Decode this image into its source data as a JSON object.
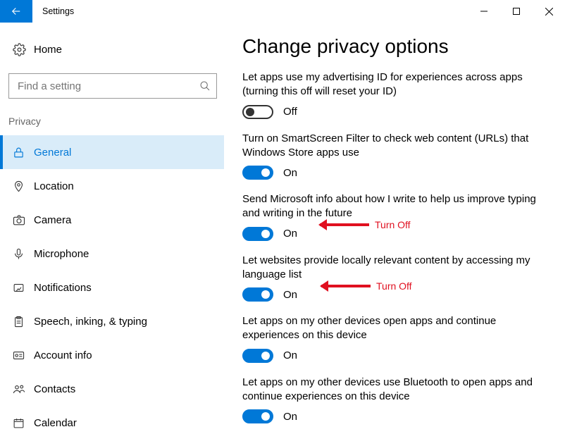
{
  "titlebar": {
    "app_title": "Settings"
  },
  "sidebar": {
    "home_label": "Home",
    "search_placeholder": "Find a setting",
    "section_header": "Privacy",
    "items": [
      {
        "label": "General"
      },
      {
        "label": "Location"
      },
      {
        "label": "Camera"
      },
      {
        "label": "Microphone"
      },
      {
        "label": "Notifications"
      },
      {
        "label": "Speech, inking, & typing"
      },
      {
        "label": "Account info"
      },
      {
        "label": "Contacts"
      },
      {
        "label": "Calendar"
      }
    ]
  },
  "main": {
    "heading": "Change privacy options",
    "toggles": [
      {
        "desc": "Let apps use my advertising ID for experiences across apps (turning this off will reset your ID)",
        "state_label": "Off",
        "on": false
      },
      {
        "desc": "Turn on SmartScreen Filter to check web content (URLs) that Windows Store apps use",
        "state_label": "On",
        "on": true
      },
      {
        "desc": "Send Microsoft info about how I write to help us improve typing and writing in the future",
        "state_label": "On",
        "on": true
      },
      {
        "desc": "Let websites provide locally relevant content by accessing my language list",
        "state_label": "On",
        "on": true
      },
      {
        "desc": "Let apps on my other devices open apps and continue experiences on this device",
        "state_label": "On",
        "on": true
      },
      {
        "desc": "Let apps on my other devices use Bluetooth to open apps and continue experiences on this device",
        "state_label": "On",
        "on": true
      }
    ],
    "annotations": {
      "turn_off_1": "Turn Off",
      "turn_off_2": "Turn Off"
    }
  }
}
